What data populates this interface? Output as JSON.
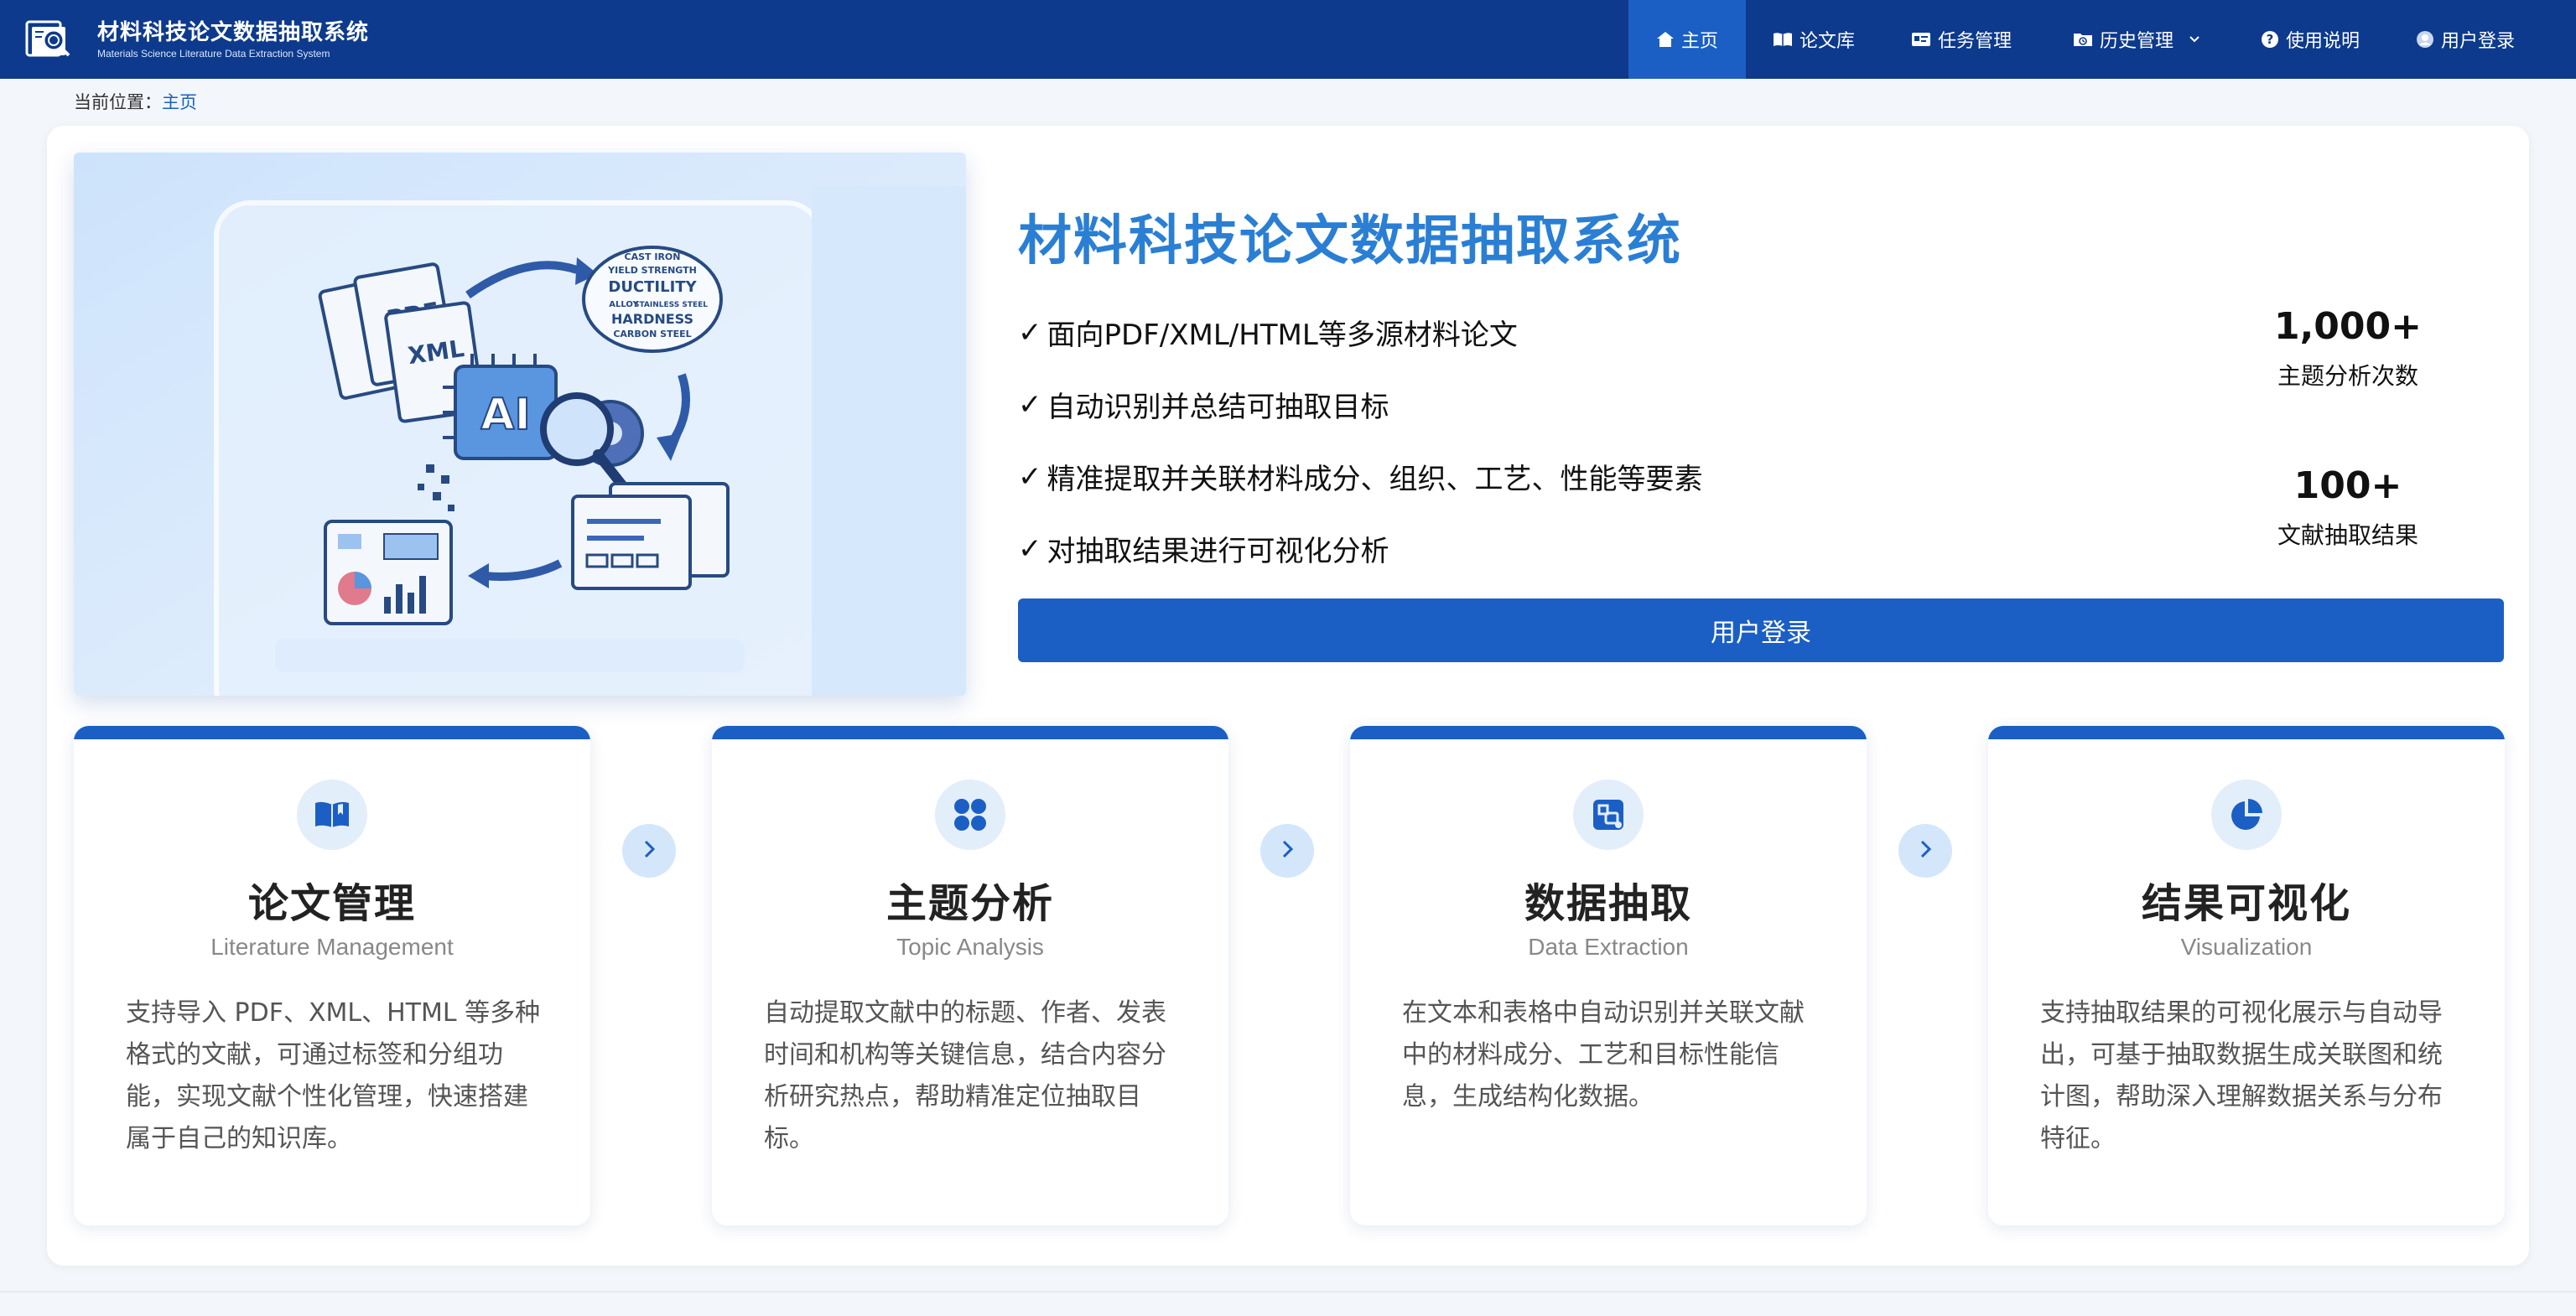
{
  "brand": {
    "title": "材料科技论文数据抽取系统",
    "subtitle": "Materials Science Literature Data Extraction System"
  },
  "nav": {
    "items": [
      {
        "label": "主页",
        "icon": "home-icon",
        "active": true
      },
      {
        "label": "论文库",
        "icon": "book-open-icon"
      },
      {
        "label": "任务管理",
        "icon": "task-card-icon"
      },
      {
        "label": "历史管理",
        "icon": "history-folder-icon",
        "dropdown": true
      },
      {
        "label": "使用说明",
        "icon": "help-circle-icon"
      },
      {
        "label": "用户登录",
        "icon": "user-avatar-icon"
      }
    ]
  },
  "breadcrumb": {
    "prefix": "当前位置：",
    "current": "主页"
  },
  "hero": {
    "illustration_text": {
      "pdf": "PDF",
      "xml": "XML",
      "ai": "AI",
      "cloud": [
        "CAST IRON",
        "YIELD STRENGTH",
        "DUCTILITY",
        "ALLOY",
        "STAINLESS STEEL",
        "HARDNESS",
        "CARBON STEEL"
      ]
    },
    "title": "材料科技论文数据抽取系统",
    "features": [
      "面向PDF/XML/HTML等多源材料论文",
      "自动识别并总结可抽取目标",
      "精准提取并关联材料成分、组织、工艺、性能等要素",
      "对抽取结果进行可视化分析"
    ],
    "check_mark": "✓",
    "stats": [
      {
        "value": "1,000+",
        "label": "主题分析次数"
      },
      {
        "value": "100+",
        "label": "文献抽取结果"
      }
    ],
    "login_button": "用户登录"
  },
  "modules": [
    {
      "icon": "book-icon",
      "title": "论文管理",
      "subtitle": "Literature Management",
      "description": "支持导入 PDF、XML、HTML 等多种格式的文献，可通过标签和分组功能，实现文献个性化管理，快速搭建属于自己的知识库。"
    },
    {
      "icon": "four-dots-grid-icon",
      "title": "主题分析",
      "subtitle": "Topic Analysis",
      "description": "自动提取文献中的标题、作者、发表时间和机构等关键信息，结合内容分析研究热点，帮助精准定位抽取目标。"
    },
    {
      "icon": "data-extract-icon",
      "title": "数据抽取",
      "subtitle": "Data Extraction",
      "description": "在文本和表格中自动识别并关联文献中的材料成分、工艺和目标性能信息，生成结构化数据。"
    },
    {
      "icon": "pie-chart-icon",
      "title": "结果可视化",
      "subtitle": "Visualization",
      "description": "支持抽取结果的可视化展示与自动导出，可基于抽取数据生成关联图和统计图，帮助深入理解数据关系与分布特征。"
    }
  ],
  "colors": {
    "nav_bg": "#0d3a8c",
    "accent": "#1b5fc4",
    "title_blue": "#2a7fd4"
  }
}
